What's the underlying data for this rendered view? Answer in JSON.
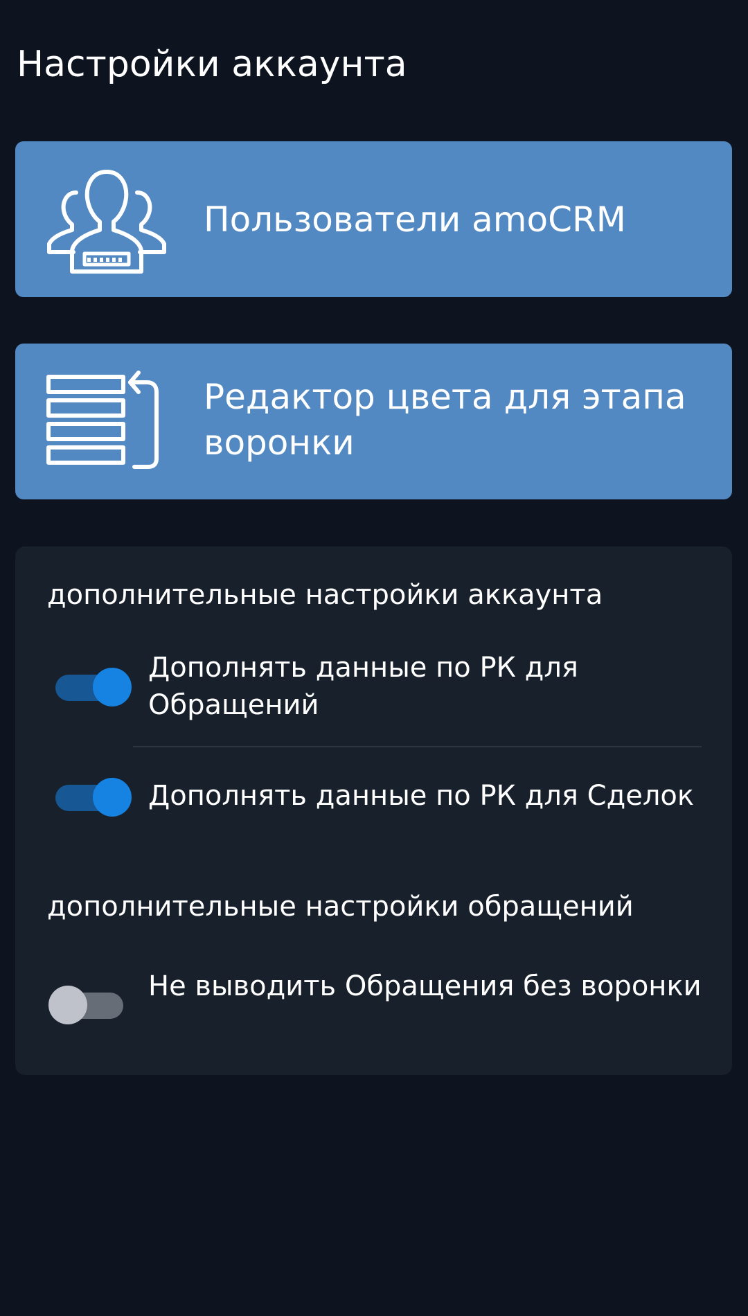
{
  "header": {
    "title": "Настройки аккаунта"
  },
  "cards": [
    {
      "label": "Пользователи amoCRM",
      "icon": "users-group-icon"
    },
    {
      "label": "Редактор цвета для этапа воронки",
      "icon": "list-reorder-icon"
    }
  ],
  "panel": {
    "sections": [
      {
        "heading": "дополнительные настройки аккаунта",
        "settings": [
          {
            "label": "Дополнять данные по РК для Обращений",
            "enabled": true
          },
          {
            "label": "Дополнять данные по РК для Сделок",
            "enabled": true
          }
        ]
      },
      {
        "heading": "дополнительные настройки обращений",
        "settings": [
          {
            "label": "Не выводить Обращения без воронки",
            "enabled": false
          }
        ]
      }
    ]
  },
  "colors": {
    "background": "#0e141f",
    "card": "#5389c2",
    "panel": "#18202b",
    "toggle_on_thumb": "#1683e3",
    "toggle_on_track": "#175793",
    "toggle_off_thumb": "#c0c2cb",
    "toggle_off_track": "#676d76"
  }
}
